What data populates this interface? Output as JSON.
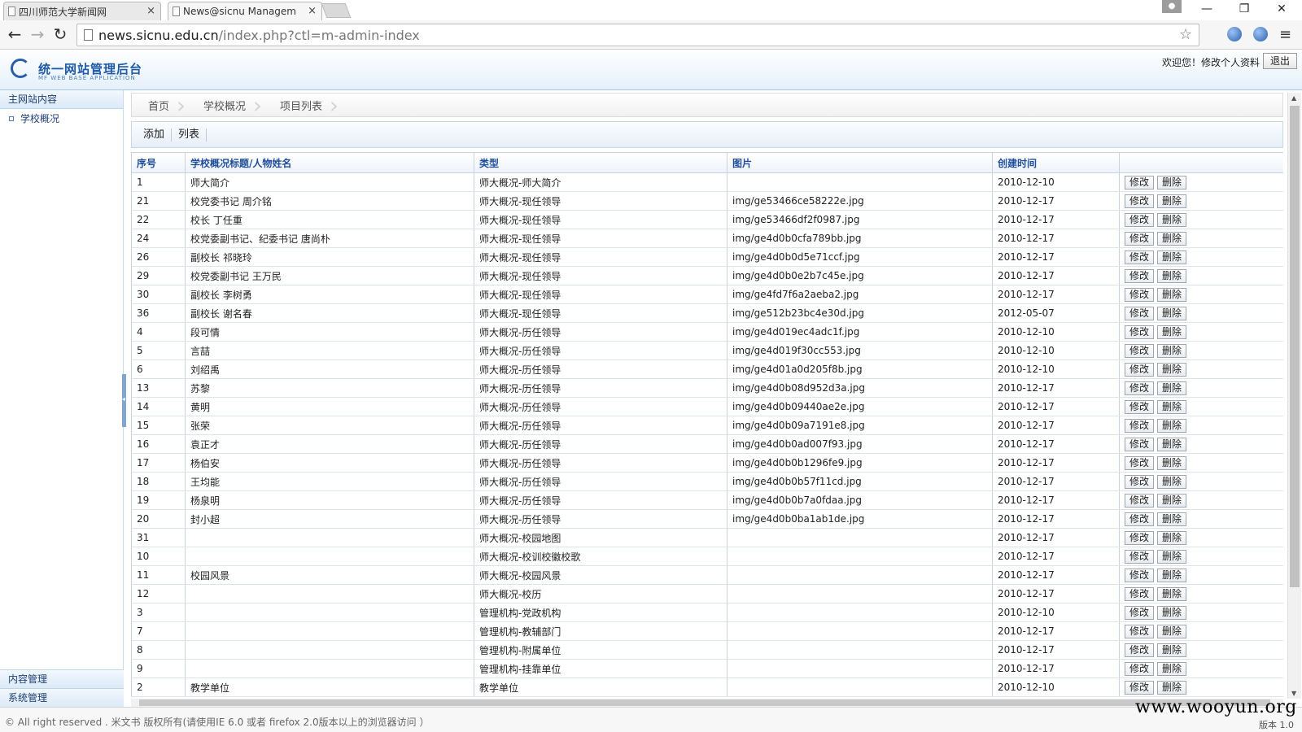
{
  "browser": {
    "tabs": [
      {
        "title": "四川师范大学新闻网",
        "close": "×"
      },
      {
        "title": "News@sicnu Managem",
        "close": "×"
      }
    ],
    "url_host": "news.sicnu.edu.cn",
    "url_path": "/index.php?ctl=m-admin-index",
    "window_controls": {
      "minimize": "—",
      "restore": "❐",
      "close": "✕"
    }
  },
  "header": {
    "logo_title": "统一网站管理后台",
    "logo_subtitle": "MF WEB BASE APPLICATION",
    "welcome": "欢迎您！修改个人资料",
    "logout": "退出"
  },
  "sidebar": {
    "section": "主网站内容",
    "items": [
      {
        "label": "学校概况"
      }
    ],
    "bottom": [
      "内容管理",
      "系统管理"
    ]
  },
  "breadcrumb": [
    "首页",
    "学校概况",
    "项目列表"
  ],
  "actions": [
    "添加",
    "列表"
  ],
  "table": {
    "headers": [
      "序号",
      "学校概况标题/人物姓名",
      "类型",
      "图片",
      "创建时间",
      ""
    ],
    "edit_label": "修改",
    "delete_label": "删除",
    "rows": [
      {
        "id": "1",
        "title": "师大简介",
        "type": "师大概况-师大简介",
        "image": "",
        "date": "2010-12-10"
      },
      {
        "id": "21",
        "title": "校党委书记 周介铭",
        "type": "师大概况-现任领导",
        "image": "img/ge53466ce58222e.jpg",
        "date": "2010-12-17"
      },
      {
        "id": "22",
        "title": "校长 丁任重",
        "type": "师大概况-现任领导",
        "image": "img/ge53466df2f0987.jpg",
        "date": "2010-12-17"
      },
      {
        "id": "24",
        "title": "校党委副书记、纪委书记 唐尚朴",
        "type": "师大概况-现任领导",
        "image": "img/ge4d0b0cfa789bb.jpg",
        "date": "2010-12-17"
      },
      {
        "id": "26",
        "title": "副校长 祁晓玲",
        "type": "师大概况-现任领导",
        "image": "img/ge4d0b0d5e71ccf.jpg",
        "date": "2010-12-17"
      },
      {
        "id": "29",
        "title": "校党委副书记 王万民",
        "type": "师大概况-现任领导",
        "image": "img/ge4d0b0e2b7c45e.jpg",
        "date": "2010-12-17"
      },
      {
        "id": "30",
        "title": "副校长 李树勇",
        "type": "师大概况-现任领导",
        "image": "img/ge4fd7f6a2aeba2.jpg",
        "date": "2010-12-17"
      },
      {
        "id": "36",
        "title": "副校长 谢名春",
        "type": "师大概况-现任领导",
        "image": "img/ge512b23bc4e30d.jpg",
        "date": "2012-05-07"
      },
      {
        "id": "4",
        "title": "段可情",
        "type": "师大概况-历任领导",
        "image": "img/ge4d019ec4adc1f.jpg",
        "date": "2010-12-10"
      },
      {
        "id": "5",
        "title": "言喆",
        "type": "师大概况-历任领导",
        "image": "img/ge4d019f30cc553.jpg",
        "date": "2010-12-10"
      },
      {
        "id": "6",
        "title": "刘绍禹",
        "type": "师大概况-历任领导",
        "image": "img/ge4d01a0d205f8b.jpg",
        "date": "2010-12-10"
      },
      {
        "id": "13",
        "title": "苏黎",
        "type": "师大概况-历任领导",
        "image": "img/ge4d0b08d952d3a.jpg",
        "date": "2010-12-17"
      },
      {
        "id": "14",
        "title": "黄明",
        "type": "师大概况-历任领导",
        "image": "img/ge4d0b09440ae2e.jpg",
        "date": "2010-12-17"
      },
      {
        "id": "15",
        "title": "张荣",
        "type": "师大概况-历任领导",
        "image": "img/ge4d0b09a7191e8.jpg",
        "date": "2010-12-17"
      },
      {
        "id": "16",
        "title": "袁正才",
        "type": "师大概况-历任领导",
        "image": "img/ge4d0b0ad007f93.jpg",
        "date": "2010-12-17"
      },
      {
        "id": "17",
        "title": "杨伯安",
        "type": "师大概况-历任领导",
        "image": "img/ge4d0b0b1296fe9.jpg",
        "date": "2010-12-17"
      },
      {
        "id": "18",
        "title": "王均能",
        "type": "师大概况-历任领导",
        "image": "img/ge4d0b0b57f11cd.jpg",
        "date": "2010-12-17"
      },
      {
        "id": "19",
        "title": "杨泉明",
        "type": "师大概况-历任领导",
        "image": "img/ge4d0b0b7a0fdaa.jpg",
        "date": "2010-12-17"
      },
      {
        "id": "20",
        "title": "封小超",
        "type": "师大概况-历任领导",
        "image": "img/ge4d0b0ba1ab1de.jpg",
        "date": "2010-12-17"
      },
      {
        "id": "31",
        "title": "",
        "type": "师大概况-校园地图",
        "image": "",
        "date": "2010-12-17"
      },
      {
        "id": "10",
        "title": "",
        "type": "师大概况-校训校徽校歌",
        "image": "",
        "date": "2010-12-17"
      },
      {
        "id": "11",
        "title": "校园风景",
        "type": "师大概况-校园风景",
        "image": "",
        "date": "2010-12-17"
      },
      {
        "id": "12",
        "title": "",
        "type": "师大概况-校历",
        "image": "",
        "date": "2010-12-17"
      },
      {
        "id": "3",
        "title": "",
        "type": "管理机构-党政机构",
        "image": "",
        "date": "2010-12-10"
      },
      {
        "id": "7",
        "title": "",
        "type": "管理机构-教辅部门",
        "image": "",
        "date": "2010-12-17"
      },
      {
        "id": "8",
        "title": "",
        "type": "管理机构-附属单位",
        "image": "",
        "date": "2010-12-17"
      },
      {
        "id": "9",
        "title": "",
        "type": "管理机构-挂靠单位",
        "image": "",
        "date": "2010-12-17"
      },
      {
        "id": "2",
        "title": "教学单位",
        "type": "教学单位",
        "image": "",
        "date": "2010-12-10"
      }
    ]
  },
  "footer": {
    "copyright": "© All right reserved . 米文书 版权所有(请使用IE 6.0 或者 firefox 2.0版本以上的浏览器访问 ）",
    "version": "版本 1.0"
  },
  "watermark": "www.wooyun.org"
}
